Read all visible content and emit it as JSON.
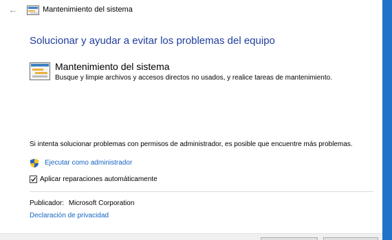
{
  "window": {
    "title": "Mantenimiento del sistema",
    "back_icon": "back-arrow-icon"
  },
  "main": {
    "headline": "Solucionar y ayudar a evitar los problemas del equipo",
    "troubleshooter": {
      "icon": "system-maintenance-icon",
      "title": "Mantenimiento del sistema",
      "description": "Busque y limpie archivos y accesos directos no usados, y realice tareas de mantenimiento."
    },
    "admin_note": "Si intenta solucionar problemas con permisos de administrador, es posible que encuentre más problemas.",
    "run_as_admin": {
      "icon": "uac-shield-icon",
      "label": "Ejecutar como administrador"
    },
    "auto_repair": {
      "label": "Aplicar reparaciones automáticamente",
      "checked": true
    },
    "publisher": {
      "label": "Publicador:",
      "value": "Microsoft Corporation"
    },
    "privacy_link": "Declaración de privacidad"
  },
  "colors": {
    "headline": "#1e3d9c",
    "link": "#1464c0",
    "desktop_edge": "#1d74c9"
  }
}
